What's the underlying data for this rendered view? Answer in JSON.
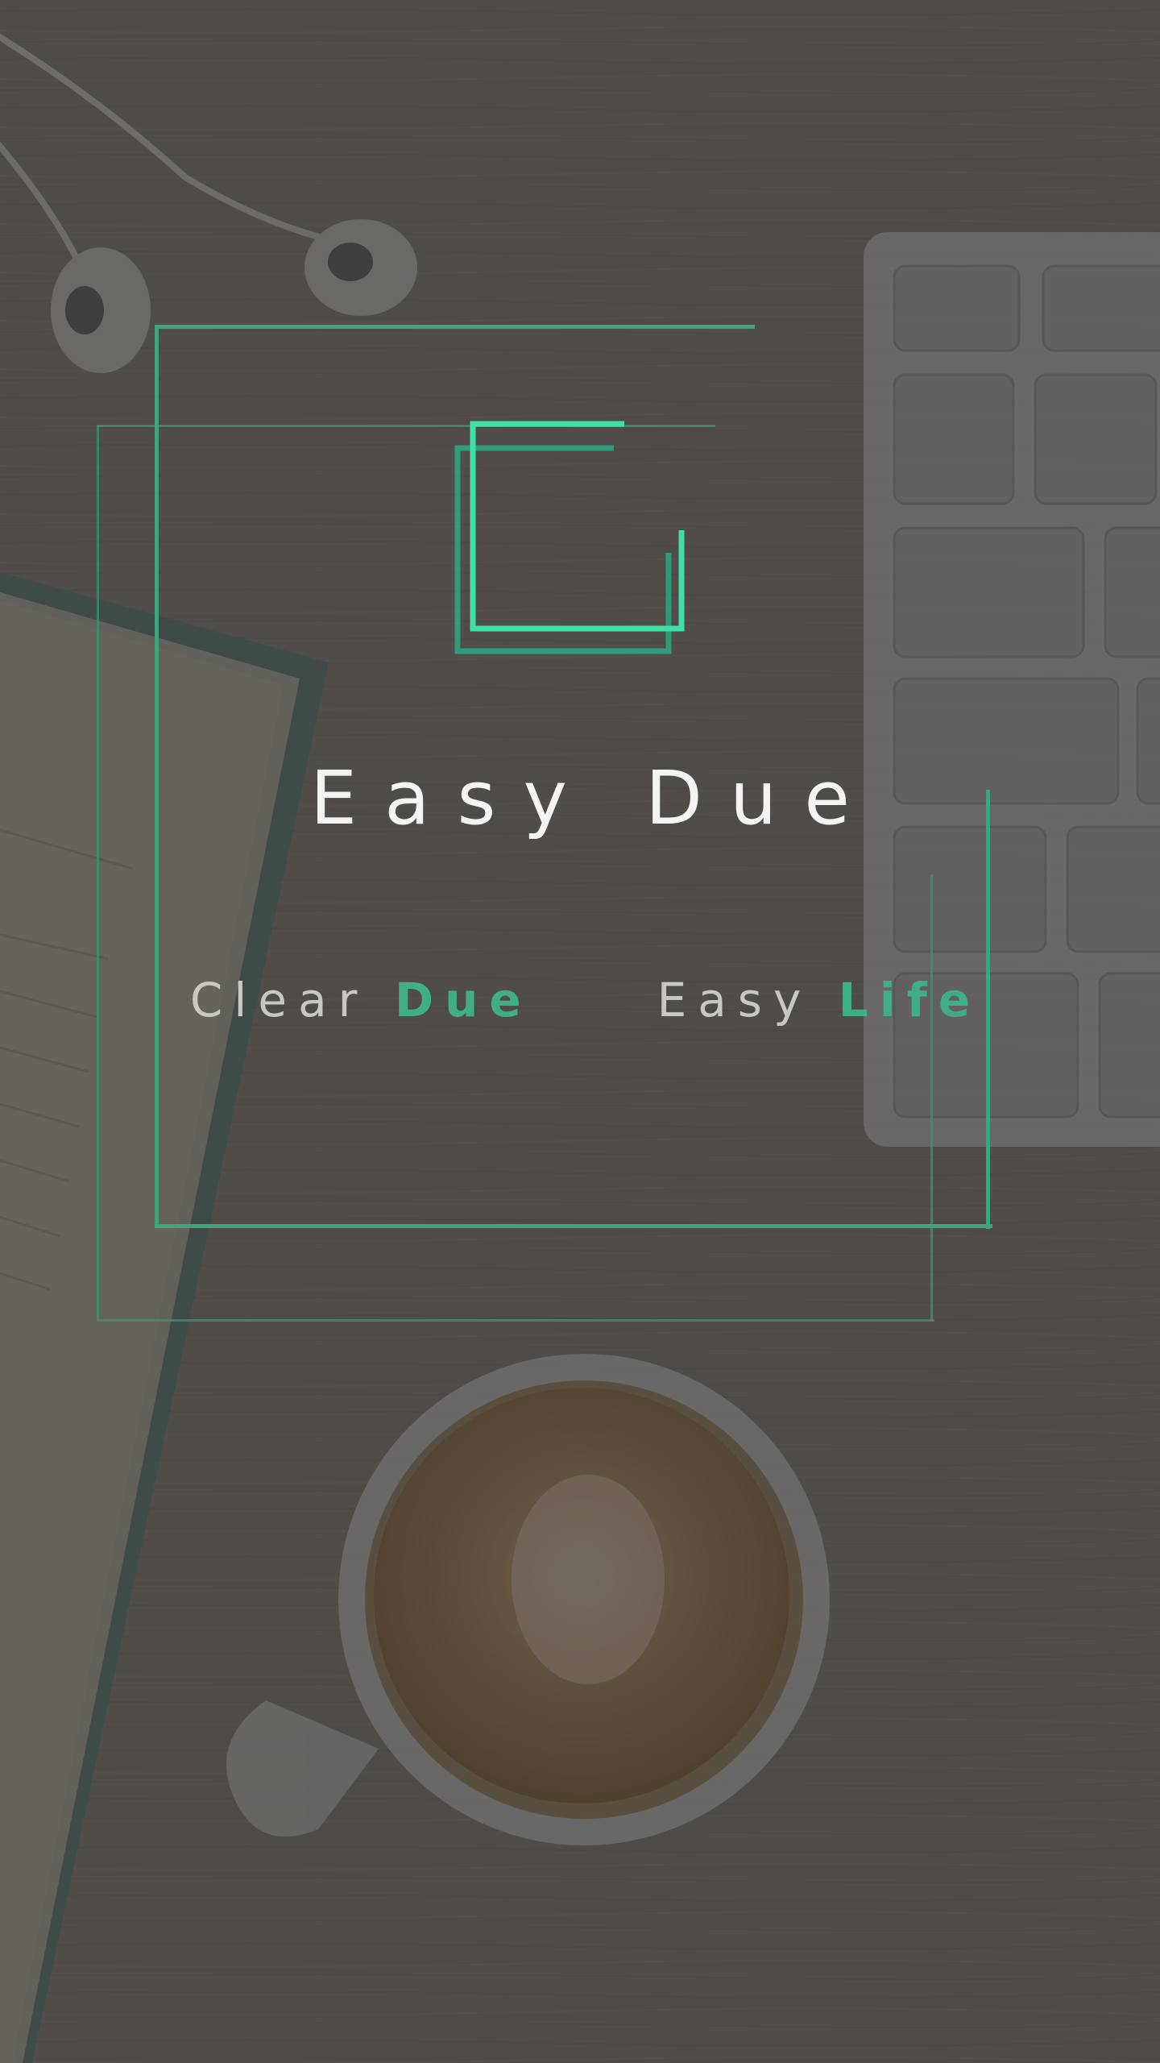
{
  "app": {
    "title": "Easy Due",
    "tagline": {
      "part1": "Clear",
      "part2": "Due",
      "part3": "Easy",
      "part4": "Life"
    }
  },
  "colors": {
    "accent": "#3fe0a8",
    "accent_dark": "#2f9b78",
    "frame": "#3fa37c",
    "title": "#f4f4f2",
    "tagline_light": "#c9c7c2",
    "tagline_green": "#3fae84"
  },
  "background": {
    "scene_items": [
      "earphones-icon",
      "keyboard-icon",
      "notebook-icon",
      "coffee-cup-icon"
    ]
  }
}
